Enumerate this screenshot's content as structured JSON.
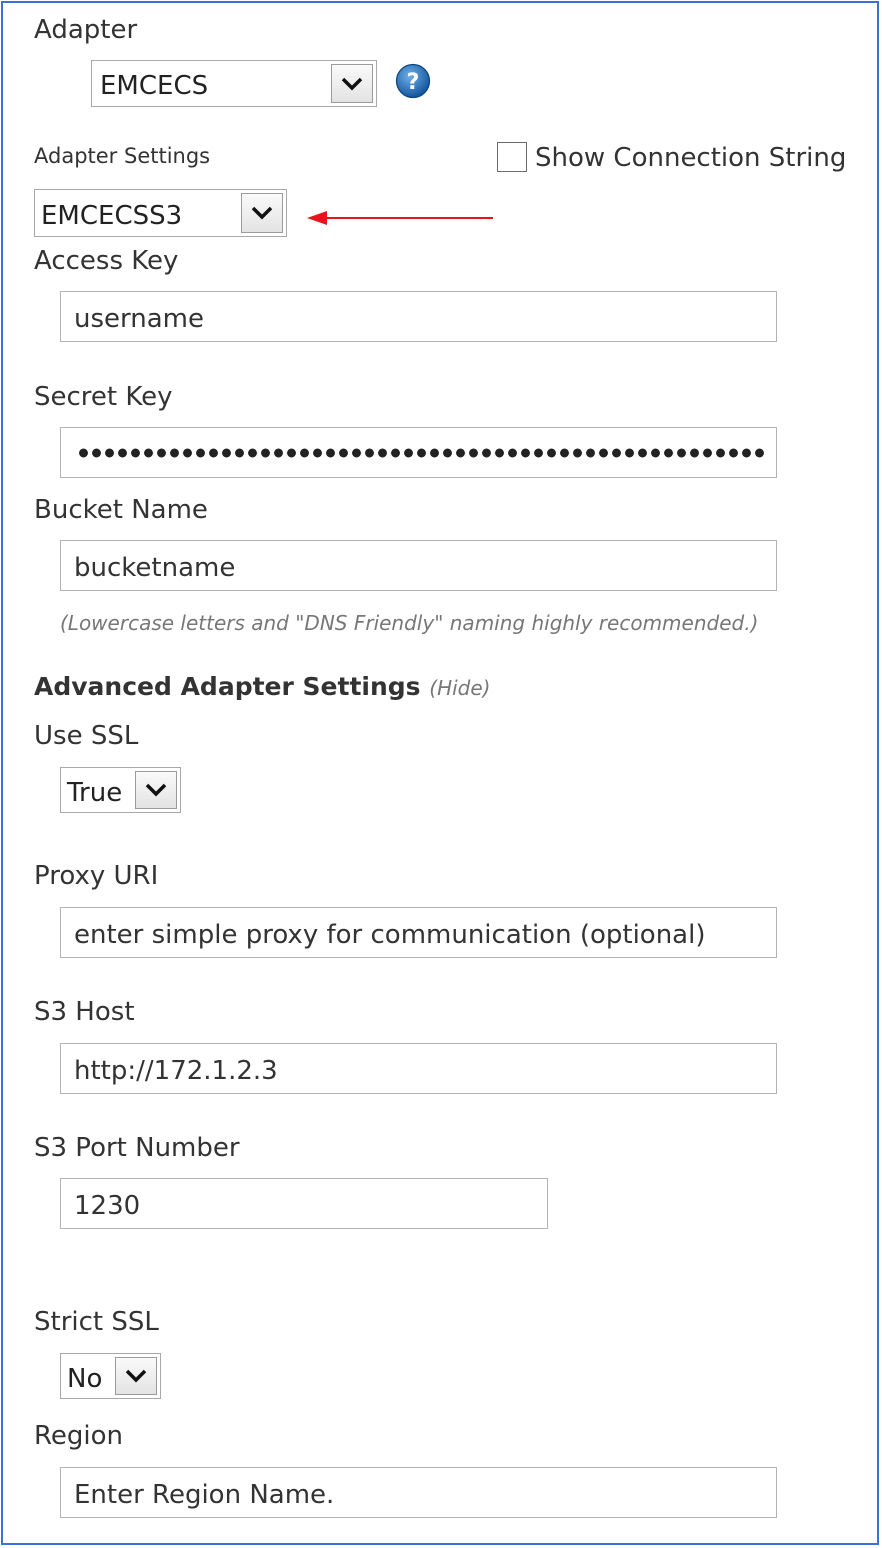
{
  "adapter": {
    "label": "Adapter",
    "value": "EMCECS"
  },
  "adapter_settings": {
    "label": "Adapter Settings",
    "value": "EMCECSS3"
  },
  "show_connection_string": {
    "label": "Show Connection String",
    "checked": false
  },
  "access_key": {
    "label": "Access Key",
    "value": "username"
  },
  "secret_key": {
    "label": "Secret Key",
    "masked": true
  },
  "bucket_name": {
    "label": "Bucket Name",
    "value": "bucketname",
    "hint": "(Lowercase letters and \"DNS Friendly\" naming highly recommended.)"
  },
  "advanced": {
    "title": "Advanced Adapter Settings",
    "toggle": "(Hide)"
  },
  "use_ssl": {
    "label": "Use SSL",
    "value": "True"
  },
  "proxy_uri": {
    "label": "Proxy URI",
    "placeholder": "enter simple proxy for communication (optional)"
  },
  "s3_host": {
    "label": "S3 Host",
    "value": "http://172.1.2.3"
  },
  "s3_port": {
    "label": "S3 Port Number",
    "value": "1230"
  },
  "strict_ssl": {
    "label": "Strict SSL",
    "value": "No"
  },
  "region": {
    "label": "Region",
    "placeholder": "Enter Region Name."
  },
  "colors": {
    "frame": "#3c6fd8",
    "arrow": "#e8141a",
    "help_icon": "#1f6fb8"
  },
  "icons": {
    "help": "help-icon",
    "dropdown": "chevron-down-icon",
    "annotation": "red-arrow"
  }
}
